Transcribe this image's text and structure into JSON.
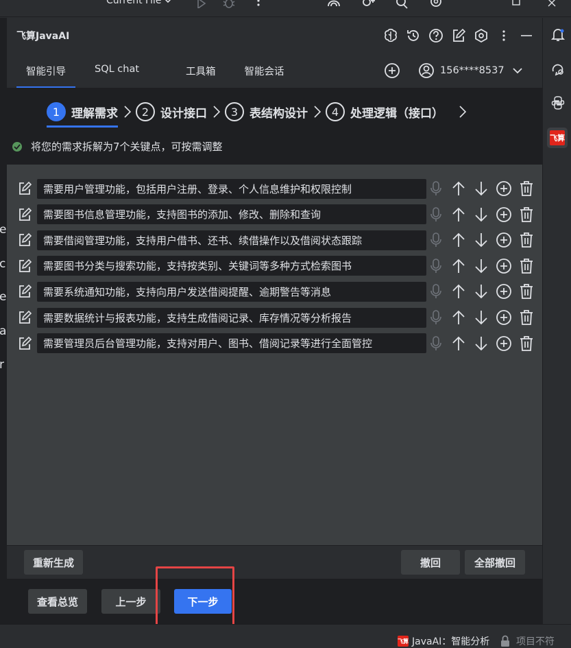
{
  "topbar": {
    "run_config": "Current File"
  },
  "editor_strip": {
    "chars": [
      "e",
      "c",
      "e",
      "a",
      "r"
    ]
  },
  "right_strip": {
    "logo_text": "飞算"
  },
  "panel": {
    "title": "飞算JavaAI",
    "tabs": [
      {
        "label": "智能引导",
        "active": true
      },
      {
        "label": "SQL chat",
        "active": false
      },
      {
        "label": "工具箱",
        "active": false
      },
      {
        "label": "智能会话",
        "active": false
      }
    ],
    "account": "156****8537"
  },
  "steps": [
    {
      "num": "1",
      "label": "理解需求",
      "active": true
    },
    {
      "num": "2",
      "label": "设计接口",
      "active": false
    },
    {
      "num": "3",
      "label": "表结构设计",
      "active": false
    },
    {
      "num": "4",
      "label": "处理逻辑（接口）",
      "active": false
    }
  ],
  "notice": "将您的需求拆解为7个关键点，可按需调整",
  "requirements": [
    "需要用户管理功能，包括用户注册、登录、个人信息维护和权限控制",
    "需要图书信息管理功能，支持图书的添加、修改、删除和查询",
    "需要借阅管理功能，支持用户借书、还书、续借操作以及借阅状态跟踪",
    "需要图书分类与搜索功能，支持按类别、关键词等多种方式检索图书",
    "需要系统通知功能，支持向用户发送借阅提醒、逾期警告等消息",
    "需要数据统计与报表功能，支持生成借阅记录、库存情况等分析报告",
    "需要管理员后台管理功能，支持对用户、图书、借阅记录等进行全面管控"
  ],
  "buttons": {
    "regenerate": "重新生成",
    "undo": "撤回",
    "undo_all": "全部撤回",
    "overview": "查看总览",
    "prev": "上一步",
    "next": "下一步"
  },
  "status": {
    "logo_text": "飞算",
    "text": "JavaAI：智能分析",
    "text2": "项目不符"
  },
  "colors": {
    "accent": "#3574f0",
    "success": "#57965c",
    "highlight": "#e54545",
    "brand": "#e1251b"
  }
}
